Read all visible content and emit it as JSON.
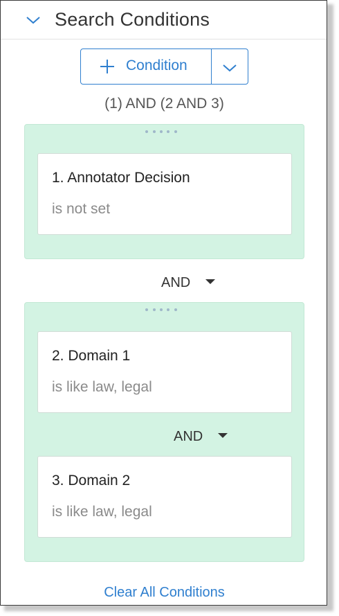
{
  "header": {
    "title": "Search Conditions"
  },
  "add_button": {
    "label": "Condition"
  },
  "logic_summary": "(1) AND (2 AND 3)",
  "groups": [
    {
      "conditions": [
        {
          "title": "1. Annotator Decision",
          "subtitle": "is not set"
        }
      ]
    },
    {
      "conditions": [
        {
          "title": "2. Domain 1",
          "subtitle": "is like law, legal"
        },
        {
          "title": "3. Domain 2",
          "subtitle": "is like law, legal"
        }
      ],
      "inner_operator": "AND"
    }
  ],
  "group_operator": "AND",
  "clear_all": "Clear All Conditions",
  "colors": {
    "accent": "#2f7fcf",
    "group_bg": "#d3f3e3"
  }
}
